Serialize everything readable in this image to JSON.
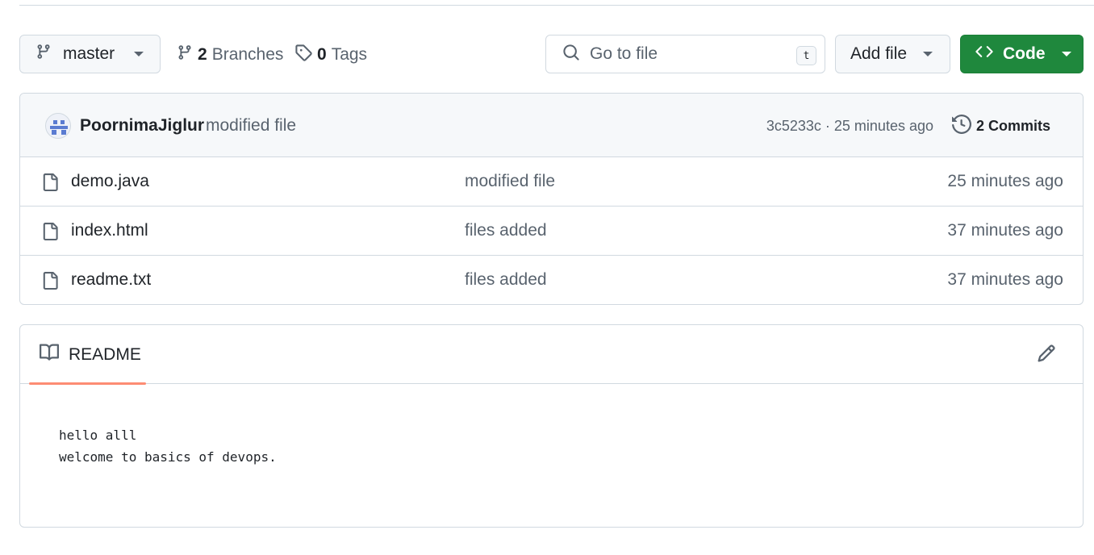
{
  "toolbar": {
    "branch_label": "master",
    "branches_count": "2",
    "branches_label": "Branches",
    "tags_count": "0",
    "tags_label": "Tags",
    "search_placeholder": "Go to file",
    "search_shortcut": "t",
    "add_file_label": "Add file",
    "code_label": "Code",
    "code_button_color": "#1f883d"
  },
  "latest_commit": {
    "author": "PoornimaJiglur",
    "message": "modified file",
    "hash_and_time": "3c5233c · 25 minutes ago",
    "commits_label": "2 Commits"
  },
  "files": [
    {
      "name": "demo.java",
      "message": "modified file",
      "time": "25 minutes ago",
      "icon": "file-icon"
    },
    {
      "name": "index.html",
      "message": "files added",
      "time": "37 minutes ago",
      "icon": "file-icon"
    },
    {
      "name": "readme.txt",
      "message": "files added",
      "time": "37 minutes ago",
      "icon": "file-icon"
    }
  ],
  "readme": {
    "tab_label": "README",
    "tab_accent_color": "#fd8c73",
    "lines": [
      "hello alll",
      "welcome to basics of devops."
    ]
  }
}
